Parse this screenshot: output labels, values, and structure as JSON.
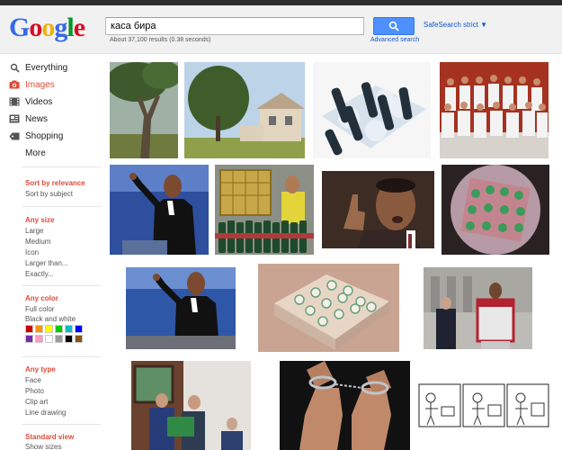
{
  "logo": {
    "letters": [
      "G",
      "o",
      "o",
      "g",
      "l",
      "e"
    ],
    "colors": [
      "#3369e8",
      "#d50f25",
      "#eeb211",
      "#3369e8",
      "#009925",
      "#d50f25"
    ]
  },
  "search": {
    "query": "каса бира",
    "button_icon": "search-icon"
  },
  "safesearch": "SafeSearch strict ▼",
  "advanced_search": "Advanced search",
  "stats": "About 37,100 results (0.38 seconds)",
  "nav": [
    {
      "label": "Everything",
      "icon": "search-icon"
    },
    {
      "label": "Images",
      "icon": "camera-icon"
    },
    {
      "label": "Videos",
      "icon": "film-icon"
    },
    {
      "label": "News",
      "icon": "newspaper-icon"
    },
    {
      "label": "Shopping",
      "icon": "tag-icon"
    },
    {
      "label": "More",
      "icon": ""
    }
  ],
  "sort": {
    "selected": "Sort by relevance",
    "other": "Sort by subject"
  },
  "size": {
    "title": "Any size",
    "options": [
      "Large",
      "Medium",
      "Icon",
      "Larger than...",
      "Exactly..."
    ]
  },
  "color": {
    "title": "Any color",
    "options": [
      "Full color",
      "Black and white"
    ],
    "swatches": [
      "#cc0000",
      "#fb940b",
      "#ffff00",
      "#00cc00",
      "#03c0c6",
      "#0000ff",
      "#762ca7",
      "#ff98bf",
      "#ffffff",
      "#999999",
      "#000000",
      "#885418"
    ]
  },
  "type": {
    "title": "Any type",
    "options": [
      "Face",
      "Photo",
      "Clip art",
      "Line drawing"
    ]
  },
  "view": {
    "title": "Standard view",
    "options": [
      "Show sizes"
    ]
  },
  "results": [
    "tree-photo",
    "house-photo",
    "beer-crate-photo",
    "hockey-team-photo",
    "obama-podium-photo",
    "bottles-warehouse-photo",
    "obama-thumbsup-photo",
    "crate-top-photo",
    "obama-stage-photo",
    "crate-ice-photo",
    "obama-jersey-photo",
    "people-crate-photo",
    "handcuffs-photo",
    "comic-strip-drawing"
  ]
}
